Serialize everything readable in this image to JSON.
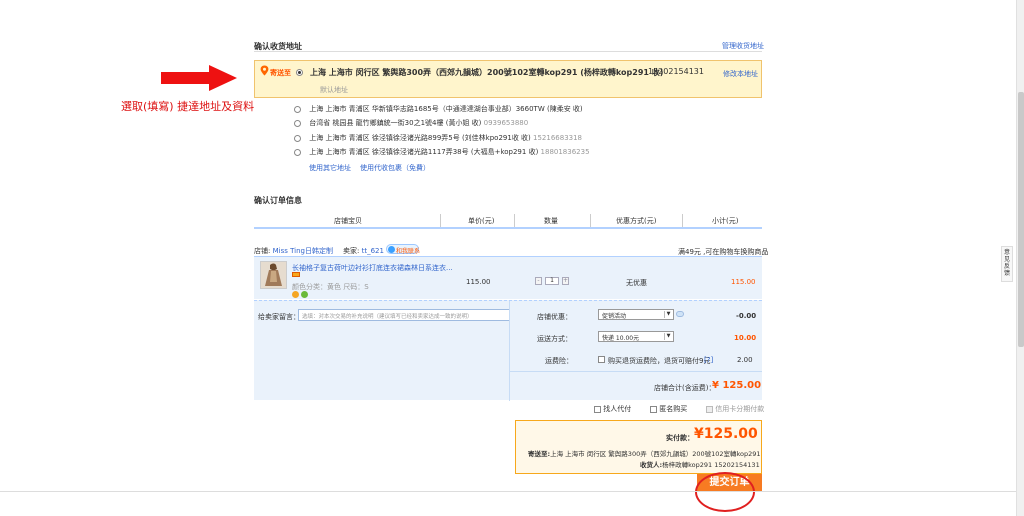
{
  "address": {
    "section_title": "确认收货地址",
    "manage_link": "管理收货地址",
    "ship_to_label": "寄送至",
    "selected": {
      "text": "上海 上海市 闵行区 繁舆路300弄（西郊九韻城）200號102室轉kop291 (杨梓政轉kop291 收) ",
      "phone": "15202154131",
      "edit_link": "修改本地址",
      "default_label": "默认地址"
    },
    "options": [
      {
        "text": "上海 上海市 青浦区 华新镇华志路1685号（中通達達湖台事业部）3660TW (陳柔安 收) "
      },
      {
        "text": "台湾省 桃园县 龍竹鄉鎮統一街30之1號4樓 (黃小姐 收) ",
        "phone": "0939653880"
      },
      {
        "text": "上海 上海市 青浦区 徐泾镇徐泾诸光路899弄5号 (刘佳林kpo291收 收) ",
        "phone": "15216683318"
      },
      {
        "text": "上海 上海市 青浦区 徐泾镇徐泾诸光路1117弄38号 (大福島+kop291 收) ",
        "phone": "18801836235"
      }
    ],
    "use_other": "使用其它地址",
    "use_pickup": "使用代收包裹（免費）"
  },
  "annotation": {
    "text": "選取(填寫) 捷達地址及資料",
    "arrow_color": "#ee1111"
  },
  "order": {
    "section_title": "确认订单信息",
    "headers": [
      "店铺宝贝",
      "单价(元)",
      "数量",
      "优惠方式(元)",
      "小计(元)"
    ],
    "store_label": "店铺:",
    "store_name": "Miss Ting日韩定制",
    "seller_label": "卖家:",
    "seller_name": "tt_621",
    "contact_label": "和我联系",
    "free_shipping_note": "满49元 ,可在购物车换购商品",
    "item": {
      "title": "长袖格子复古荷叶边衬衫打底连衣裙森林日系连衣...",
      "spec": "颜色分类：黄色   尺码：S",
      "price": "115.00",
      "quantity": "1",
      "discount": "无优惠",
      "subtotal": "115.00"
    },
    "message_label": "给卖家留言：",
    "message_placeholder": "选填：对本次交易的补充说明（建议填写已经和卖家达成一致的说明）",
    "store_discount_label": "店铺优惠：",
    "store_discount_value": "促销活动",
    "store_discount_amount": "-0.00",
    "shipping_label": "运送方式：",
    "shipping_value": "快递 10.00元",
    "shipping_amount": "10.00",
    "insurance_label": "运费险：",
    "insurance_text": "购买退货运费险，退货可赔付9元",
    "insurance_help": "[?]",
    "insurance_amount": "2.00",
    "store_total_label": "店铺合计(含运费)：",
    "store_total_value": "¥ 125.00"
  },
  "options": {
    "agent_pay": "找人代付",
    "anonymous": "匿名购买",
    "credit_installment": "信用卡分期付款"
  },
  "summary": {
    "pay_label": "实付款：",
    "pay_value": "¥125.00",
    "ship_to_label": "寄送至:",
    "ship_to_value": "上海 上海市 闵行区 繁舆路300弄（西郊九韻城）200號102室轉kop291",
    "receiver_label": "收货人:",
    "receiver_value": "杨梓政轉kop291 15202154131"
  },
  "submit_label": "提交订单",
  "side_tab": "意见反馈",
  "colors": {
    "selected_bg": "#fff5cc",
    "selected_border": "#f0c36d",
    "panel_bg": "#eaf2fb",
    "accent": "#ff5500",
    "submit_bg": "#f77b22"
  }
}
